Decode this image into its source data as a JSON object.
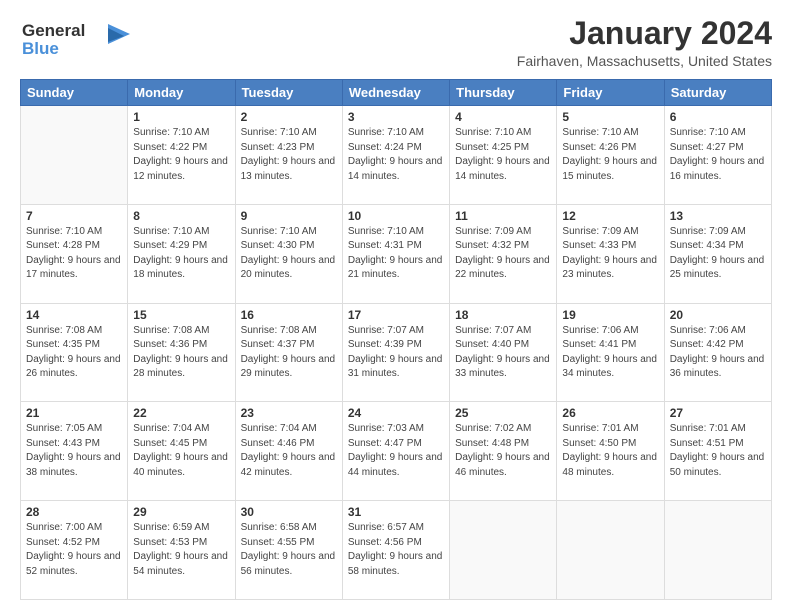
{
  "logo": {
    "line1": "General",
    "line2": "Blue"
  },
  "title": "January 2024",
  "subtitle": "Fairhaven, Massachusetts, United States",
  "days_header": [
    "Sunday",
    "Monday",
    "Tuesday",
    "Wednesday",
    "Thursday",
    "Friday",
    "Saturday"
  ],
  "weeks": [
    [
      {
        "day": "",
        "sunrise": "",
        "sunset": "",
        "daylight": ""
      },
      {
        "day": "1",
        "sunrise": "Sunrise: 7:10 AM",
        "sunset": "Sunset: 4:22 PM",
        "daylight": "Daylight: 9 hours and 12 minutes."
      },
      {
        "day": "2",
        "sunrise": "Sunrise: 7:10 AM",
        "sunset": "Sunset: 4:23 PM",
        "daylight": "Daylight: 9 hours and 13 minutes."
      },
      {
        "day": "3",
        "sunrise": "Sunrise: 7:10 AM",
        "sunset": "Sunset: 4:24 PM",
        "daylight": "Daylight: 9 hours and 14 minutes."
      },
      {
        "day": "4",
        "sunrise": "Sunrise: 7:10 AM",
        "sunset": "Sunset: 4:25 PM",
        "daylight": "Daylight: 9 hours and 14 minutes."
      },
      {
        "day": "5",
        "sunrise": "Sunrise: 7:10 AM",
        "sunset": "Sunset: 4:26 PM",
        "daylight": "Daylight: 9 hours and 15 minutes."
      },
      {
        "day": "6",
        "sunrise": "Sunrise: 7:10 AM",
        "sunset": "Sunset: 4:27 PM",
        "daylight": "Daylight: 9 hours and 16 minutes."
      }
    ],
    [
      {
        "day": "7",
        "sunrise": "Sunrise: 7:10 AM",
        "sunset": "Sunset: 4:28 PM",
        "daylight": "Daylight: 9 hours and 17 minutes."
      },
      {
        "day": "8",
        "sunrise": "Sunrise: 7:10 AM",
        "sunset": "Sunset: 4:29 PM",
        "daylight": "Daylight: 9 hours and 18 minutes."
      },
      {
        "day": "9",
        "sunrise": "Sunrise: 7:10 AM",
        "sunset": "Sunset: 4:30 PM",
        "daylight": "Daylight: 9 hours and 20 minutes."
      },
      {
        "day": "10",
        "sunrise": "Sunrise: 7:10 AM",
        "sunset": "Sunset: 4:31 PM",
        "daylight": "Daylight: 9 hours and 21 minutes."
      },
      {
        "day": "11",
        "sunrise": "Sunrise: 7:09 AM",
        "sunset": "Sunset: 4:32 PM",
        "daylight": "Daylight: 9 hours and 22 minutes."
      },
      {
        "day": "12",
        "sunrise": "Sunrise: 7:09 AM",
        "sunset": "Sunset: 4:33 PM",
        "daylight": "Daylight: 9 hours and 23 minutes."
      },
      {
        "day": "13",
        "sunrise": "Sunrise: 7:09 AM",
        "sunset": "Sunset: 4:34 PM",
        "daylight": "Daylight: 9 hours and 25 minutes."
      }
    ],
    [
      {
        "day": "14",
        "sunrise": "Sunrise: 7:08 AM",
        "sunset": "Sunset: 4:35 PM",
        "daylight": "Daylight: 9 hours and 26 minutes."
      },
      {
        "day": "15",
        "sunrise": "Sunrise: 7:08 AM",
        "sunset": "Sunset: 4:36 PM",
        "daylight": "Daylight: 9 hours and 28 minutes."
      },
      {
        "day": "16",
        "sunrise": "Sunrise: 7:08 AM",
        "sunset": "Sunset: 4:37 PM",
        "daylight": "Daylight: 9 hours and 29 minutes."
      },
      {
        "day": "17",
        "sunrise": "Sunrise: 7:07 AM",
        "sunset": "Sunset: 4:39 PM",
        "daylight": "Daylight: 9 hours and 31 minutes."
      },
      {
        "day": "18",
        "sunrise": "Sunrise: 7:07 AM",
        "sunset": "Sunset: 4:40 PM",
        "daylight": "Daylight: 9 hours and 33 minutes."
      },
      {
        "day": "19",
        "sunrise": "Sunrise: 7:06 AM",
        "sunset": "Sunset: 4:41 PM",
        "daylight": "Daylight: 9 hours and 34 minutes."
      },
      {
        "day": "20",
        "sunrise": "Sunrise: 7:06 AM",
        "sunset": "Sunset: 4:42 PM",
        "daylight": "Daylight: 9 hours and 36 minutes."
      }
    ],
    [
      {
        "day": "21",
        "sunrise": "Sunrise: 7:05 AM",
        "sunset": "Sunset: 4:43 PM",
        "daylight": "Daylight: 9 hours and 38 minutes."
      },
      {
        "day": "22",
        "sunrise": "Sunrise: 7:04 AM",
        "sunset": "Sunset: 4:45 PM",
        "daylight": "Daylight: 9 hours and 40 minutes."
      },
      {
        "day": "23",
        "sunrise": "Sunrise: 7:04 AM",
        "sunset": "Sunset: 4:46 PM",
        "daylight": "Daylight: 9 hours and 42 minutes."
      },
      {
        "day": "24",
        "sunrise": "Sunrise: 7:03 AM",
        "sunset": "Sunset: 4:47 PM",
        "daylight": "Daylight: 9 hours and 44 minutes."
      },
      {
        "day": "25",
        "sunrise": "Sunrise: 7:02 AM",
        "sunset": "Sunset: 4:48 PM",
        "daylight": "Daylight: 9 hours and 46 minutes."
      },
      {
        "day": "26",
        "sunrise": "Sunrise: 7:01 AM",
        "sunset": "Sunset: 4:50 PM",
        "daylight": "Daylight: 9 hours and 48 minutes."
      },
      {
        "day": "27",
        "sunrise": "Sunrise: 7:01 AM",
        "sunset": "Sunset: 4:51 PM",
        "daylight": "Daylight: 9 hours and 50 minutes."
      }
    ],
    [
      {
        "day": "28",
        "sunrise": "Sunrise: 7:00 AM",
        "sunset": "Sunset: 4:52 PM",
        "daylight": "Daylight: 9 hours and 52 minutes."
      },
      {
        "day": "29",
        "sunrise": "Sunrise: 6:59 AM",
        "sunset": "Sunset: 4:53 PM",
        "daylight": "Daylight: 9 hours and 54 minutes."
      },
      {
        "day": "30",
        "sunrise": "Sunrise: 6:58 AM",
        "sunset": "Sunset: 4:55 PM",
        "daylight": "Daylight: 9 hours and 56 minutes."
      },
      {
        "day": "31",
        "sunrise": "Sunrise: 6:57 AM",
        "sunset": "Sunset: 4:56 PM",
        "daylight": "Daylight: 9 hours and 58 minutes."
      },
      {
        "day": "",
        "sunrise": "",
        "sunset": "",
        "daylight": ""
      },
      {
        "day": "",
        "sunrise": "",
        "sunset": "",
        "daylight": ""
      },
      {
        "day": "",
        "sunrise": "",
        "sunset": "",
        "daylight": ""
      }
    ]
  ]
}
